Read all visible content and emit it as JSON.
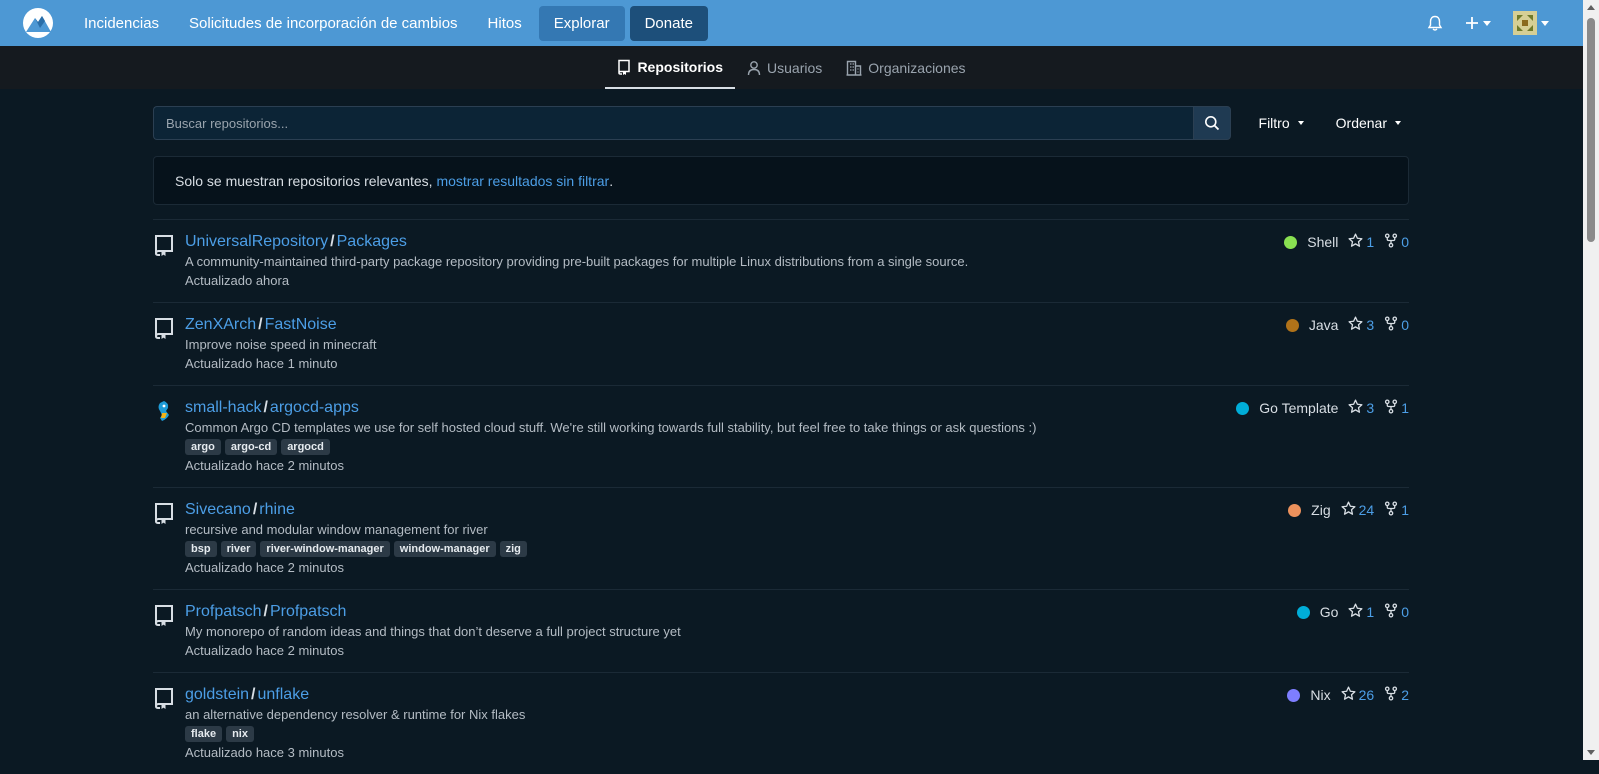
{
  "navbar": {
    "items": [
      "Incidencias",
      "Solicitudes de incorporación de cambios",
      "Hitos"
    ],
    "explore_label": "Explorar",
    "donate_label": "Donate",
    "color": "#4d98d4"
  },
  "subnav": {
    "tabs": [
      {
        "label": "Repositorios",
        "icon": "repo-icon",
        "active": true
      },
      {
        "label": "Usuarios",
        "icon": "person-icon",
        "active": false
      },
      {
        "label": "Organizaciones",
        "icon": "organization-icon",
        "active": false
      }
    ]
  },
  "search": {
    "placeholder": "Buscar repositorios...",
    "filter_label": "Filtro",
    "sort_label": "Ordenar"
  },
  "info": {
    "text": "Solo se muestran repositorios relevantes, ",
    "link": "mostrar resultados sin filtrar",
    "suffix": "."
  },
  "repos": [
    {
      "owner": "UniversalRepository",
      "name": "Packages",
      "desc": "A community-maintained third-party package repository providing pre-built packages for multiple Linux distributions from a single source.",
      "topics": [],
      "updated": "Actualizado ahora",
      "language": "Shell",
      "lang_color": "#89e051",
      "stars": "1",
      "forks": "0",
      "icon": "repo-icon"
    },
    {
      "owner": "ZenXArch",
      "name": "FastNoise",
      "desc": "Improve noise speed in minecraft",
      "topics": [],
      "updated": "Actualizado hace 1 minuto",
      "language": "Java",
      "lang_color": "#b07219",
      "stars": "3",
      "forks": "0",
      "icon": "repo-icon"
    },
    {
      "owner": "small-hack",
      "name": "argocd-apps",
      "desc": "Common Argo CD templates we use for self hosted cloud stuff. We're still working towards full stability, but feel free to take things or ask questions :)",
      "topics": [
        "argo",
        "argo-cd",
        "argocd"
      ],
      "updated": "Actualizado hace 2 minutos",
      "language": "Go Template",
      "lang_color": "#00add8",
      "stars": "3",
      "forks": "1",
      "icon": "avatar-icon"
    },
    {
      "owner": "Sivecano",
      "name": "rhine",
      "desc": "recursive and modular window management for river",
      "topics": [
        "bsp",
        "river",
        "river-window-manager",
        "window-manager",
        "zig"
      ],
      "updated": "Actualizado hace 2 minutos",
      "language": "Zig",
      "lang_color": "#ec915c",
      "stars": "24",
      "forks": "1",
      "icon": "repo-icon"
    },
    {
      "owner": "Profpatsch",
      "name": "Profpatsch",
      "desc": "My monorepo of random ideas and things that don’t deserve a full project structure yet",
      "topics": [],
      "updated": "Actualizado hace 2 minutos",
      "language": "Go",
      "lang_color": "#00add8",
      "stars": "1",
      "forks": "0",
      "icon": "repo-icon"
    },
    {
      "owner": "goldstein",
      "name": "unflake",
      "desc": "an alternative dependency resolver & runtime for Nix flakes",
      "topics": [
        "flake",
        "nix"
      ],
      "updated": "Actualizado hace 3 minutos",
      "language": "Nix",
      "lang_color": "#7e7eff",
      "stars": "26",
      "forks": "2",
      "icon": "repo-icon"
    }
  ]
}
